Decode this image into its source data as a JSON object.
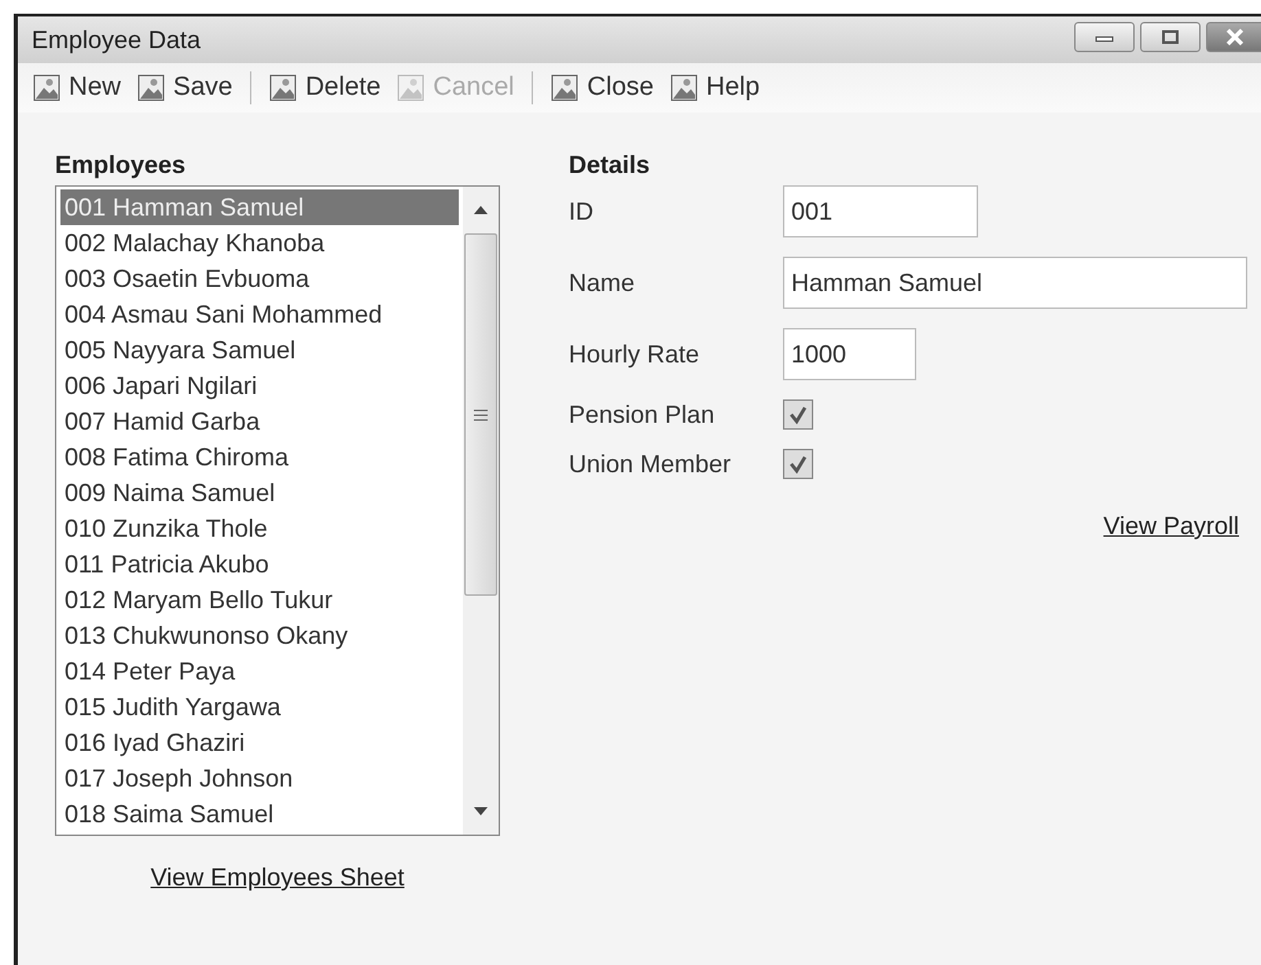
{
  "window": {
    "title": "Employee Data"
  },
  "toolbar": {
    "groups": [
      {
        "buttons": [
          {
            "label": "New",
            "disabled": false
          },
          {
            "label": "Save",
            "disabled": false
          }
        ]
      },
      {
        "buttons": [
          {
            "label": "Delete",
            "disabled": false
          },
          {
            "label": "Cancel",
            "disabled": true
          }
        ]
      },
      {
        "buttons": [
          {
            "label": "Close",
            "disabled": false
          },
          {
            "label": "Help",
            "disabled": false
          }
        ]
      }
    ]
  },
  "employees": {
    "heading": "Employees",
    "items": [
      {
        "label": "001 Hamman Samuel",
        "selected": true
      },
      {
        "label": "002 Malachay Khanoba",
        "selected": false
      },
      {
        "label": "003 Osaetin Evbuoma",
        "selected": false
      },
      {
        "label": "004 Asmau Sani Mohammed",
        "selected": false
      },
      {
        "label": "005 Nayyara Samuel",
        "selected": false
      },
      {
        "label": "006 Japari Ngilari",
        "selected": false
      },
      {
        "label": "007 Hamid Garba",
        "selected": false
      },
      {
        "label": "008 Fatima Chiroma",
        "selected": false
      },
      {
        "label": "009 Naima Samuel",
        "selected": false
      },
      {
        "label": "010 Zunzika Thole",
        "selected": false
      },
      {
        "label": "011 Patricia Akubo",
        "selected": false
      },
      {
        "label": "012 Maryam Bello Tukur",
        "selected": false
      },
      {
        "label": "013 Chukwunonso Okany",
        "selected": false
      },
      {
        "label": "014 Peter Paya",
        "selected": false
      },
      {
        "label": "015 Judith Yargawa",
        "selected": false
      },
      {
        "label": "016 Iyad Ghaziri",
        "selected": false
      },
      {
        "label": "017 Joseph Johnson",
        "selected": false
      },
      {
        "label": "018 Saima Samuel",
        "selected": false
      }
    ],
    "link": "View Employees Sheet"
  },
  "details": {
    "heading": "Details",
    "fields": [
      {
        "kind": "text",
        "label": "ID",
        "value": "001"
      },
      {
        "kind": "text",
        "label": "Name",
        "value": "Hamman Samuel"
      },
      {
        "kind": "text",
        "label": "Hourly Rate",
        "value": "1000"
      },
      {
        "kind": "checkbox",
        "label": "Pension Plan",
        "checked": true
      },
      {
        "kind": "checkbox",
        "label": "Union Member",
        "checked": true
      }
    ],
    "link": "View Payroll"
  }
}
